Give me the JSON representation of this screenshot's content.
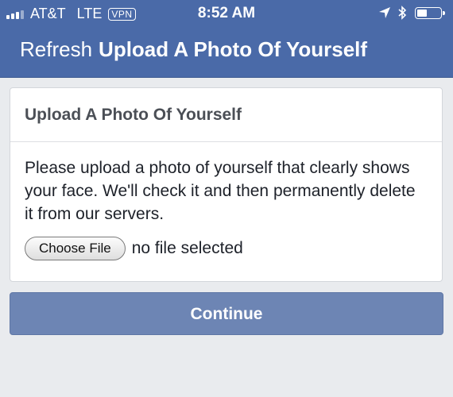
{
  "status_bar": {
    "carrier": "AT&T",
    "network": "LTE",
    "vpn": "VPN",
    "time": "8:52 AM"
  },
  "nav": {
    "refresh_label": "Refresh",
    "title": "Upload A Photo Of Yourself"
  },
  "card": {
    "header": "Upload A Photo Of Yourself",
    "description": "Please upload a photo of yourself that clearly shows your face. We'll check it and then permanently delete it from our servers.",
    "choose_file_label": "Choose File",
    "file_status": "no file selected"
  },
  "continue_label": "Continue",
  "colors": {
    "nav_bar": "#4a6aa8",
    "button": "#6d85b4",
    "background": "#e9ebee"
  },
  "icons": [
    "signal-icon",
    "location-arrow-icon",
    "bluetooth-icon",
    "battery-icon"
  ]
}
